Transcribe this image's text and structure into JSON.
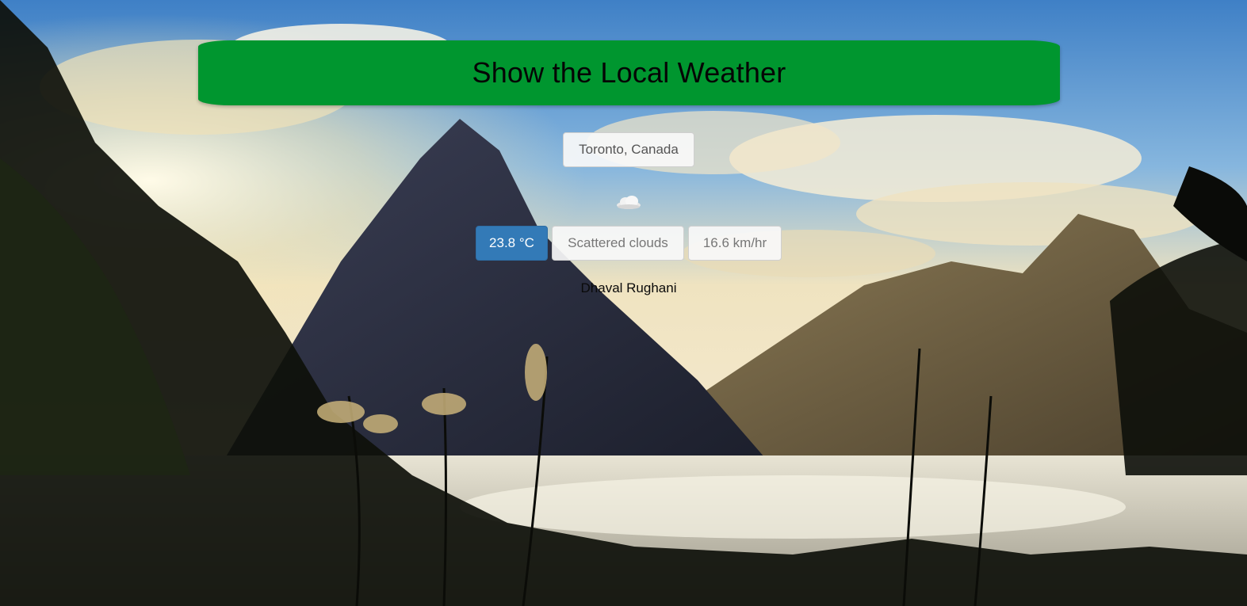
{
  "header": {
    "title": "Show the Local Weather"
  },
  "location": {
    "label": "Toronto, Canada"
  },
  "weather": {
    "icon": "cloud-icon",
    "temperature": "23.8 °C",
    "description": "Scattered clouds",
    "wind_speed": "16.6 km/hr"
  },
  "footer": {
    "author": "Dhaval Rughani"
  },
  "colors": {
    "banner": "#00962f",
    "temperature_button": "#337ab7"
  }
}
